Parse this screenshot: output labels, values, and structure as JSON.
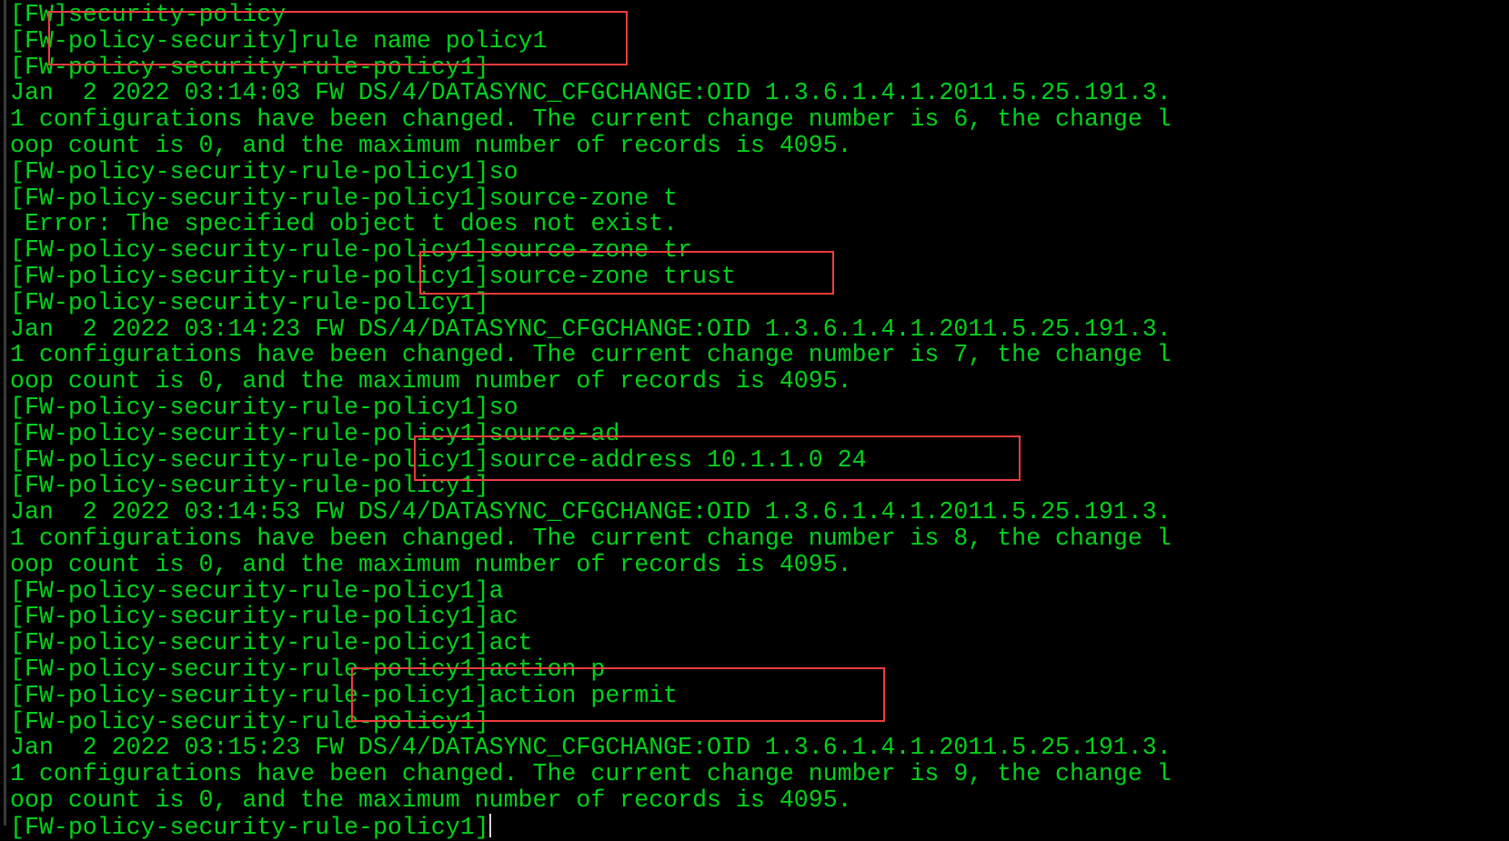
{
  "terminal": {
    "lines": [
      "[FW]security-policy",
      "[FW-policy-security]rule name policy1",
      "[FW-policy-security-rule-policy1]",
      "Jan  2 2022 03:14:03 FW DS/4/DATASYNC_CFGCHANGE:OID 1.3.6.1.4.1.2011.5.25.191.3.",
      "1 configurations have been changed. The current change number is 6, the change l",
      "oop count is 0, and the maximum number of records is 4095.",
      "[FW-policy-security-rule-policy1]so",
      "[FW-policy-security-rule-policy1]source-zone t",
      " Error: The specified object t does not exist.",
      "[FW-policy-security-rule-policy1]source-zone tr",
      "[FW-policy-security-rule-policy1]source-zone trust",
      "[FW-policy-security-rule-policy1]",
      "Jan  2 2022 03:14:23 FW DS/4/DATASYNC_CFGCHANGE:OID 1.3.6.1.4.1.2011.5.25.191.3.",
      "1 configurations have been changed. The current change number is 7, the change l",
      "oop count is 0, and the maximum number of records is 4095.",
      "[FW-policy-security-rule-policy1]so",
      "[FW-policy-security-rule-policy1]source-ad",
      "[FW-policy-security-rule-policy1]source-address 10.1.1.0 24",
      "[FW-policy-security-rule-policy1]",
      "Jan  2 2022 03:14:53 FW DS/4/DATASYNC_CFGCHANGE:OID 1.3.6.1.4.1.2011.5.25.191.3.",
      "1 configurations have been changed. The current change number is 8, the change l",
      "oop count is 0, and the maximum number of records is 4095.",
      "[FW-policy-security-rule-policy1]a",
      "[FW-policy-security-rule-policy1]ac",
      "[FW-policy-security-rule-policy1]act",
      "[FW-policy-security-rule-policy1]action p",
      "[FW-policy-security-rule-policy1]action permit",
      "[FW-policy-security-rule-policy1]",
      "Jan  2 2022 03:15:23 FW DS/4/DATASYNC_CFGCHANGE:OID 1.3.6.1.4.1.2011.5.25.191.3.",
      "1 configurations have been changed. The current change number is 9, the change l",
      "oop count is 0, and the maximum number of records is 4095.",
      "[FW-policy-security-rule-policy1]"
    ]
  },
  "colors": {
    "text": "#00d21a",
    "background": "#000000",
    "highlight": "#f03c3c"
  }
}
